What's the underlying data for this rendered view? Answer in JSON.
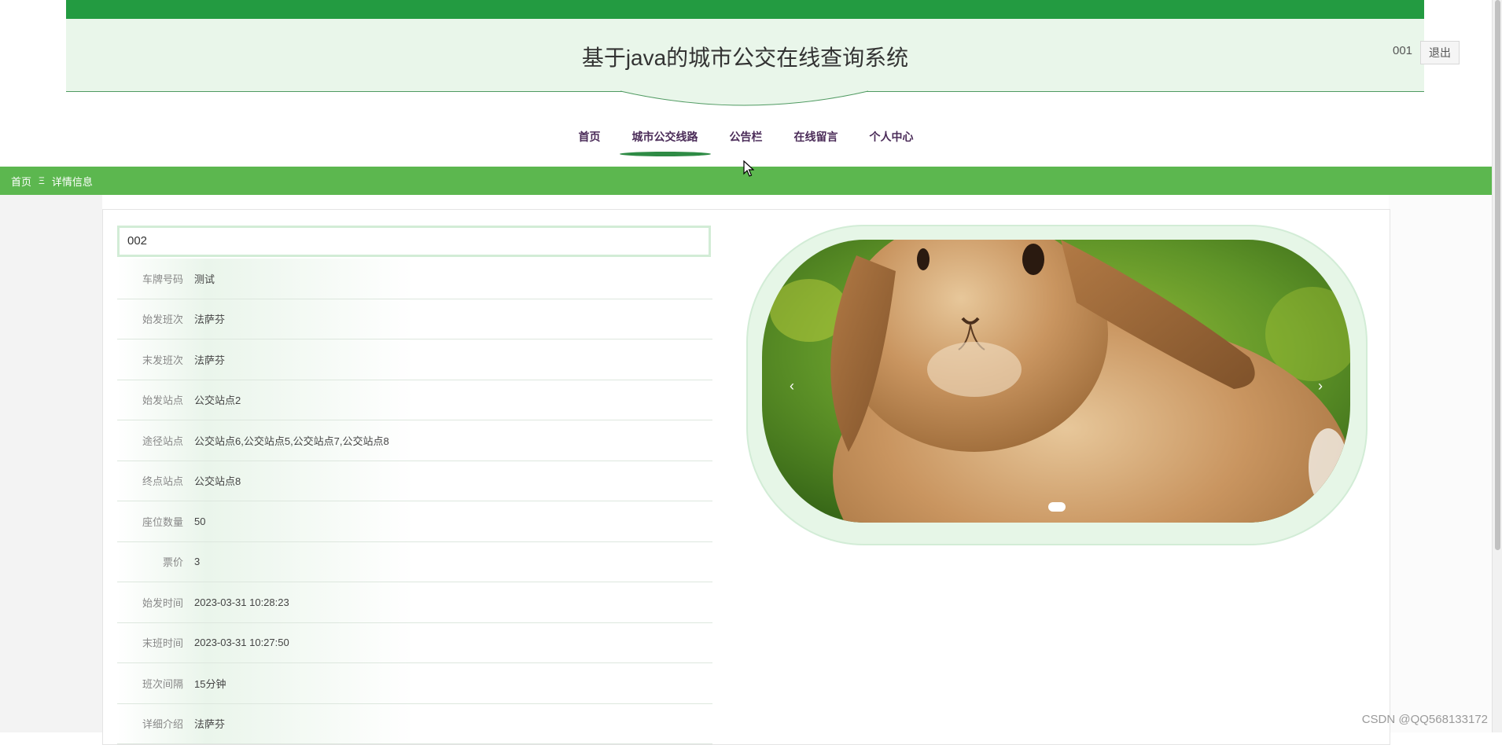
{
  "header": {
    "title": "基于java的城市公交在线查询系统",
    "user": "001",
    "logout_label": "退出"
  },
  "nav": {
    "items": [
      {
        "label": "首页"
      },
      {
        "label": "城市公交线路"
      },
      {
        "label": "公告栏"
      },
      {
        "label": "在线留言"
      },
      {
        "label": "个人中心"
      }
    ],
    "active_index": 1
  },
  "breadcrumb": {
    "home": "首页",
    "separator": "Ξ",
    "current": "详情信息"
  },
  "detail": {
    "title": "002",
    "rows": [
      {
        "label": "车牌号码",
        "value": "测试"
      },
      {
        "label": "始发班次",
        "value": "法萨芬"
      },
      {
        "label": "末发班次",
        "value": "法萨芬"
      },
      {
        "label": "始发站点",
        "value": "公交站点2"
      },
      {
        "label": "途径站点",
        "value": "公交站点6,公交站点5,公交站点7,公交站点8"
      },
      {
        "label": "终点站点",
        "value": "公交站点8"
      },
      {
        "label": "座位数量",
        "value": "50"
      },
      {
        "label": "票价",
        "value": "3"
      },
      {
        "label": "始发时间",
        "value": "2023-03-31 10:28:23"
      },
      {
        "label": "末班时间",
        "value": "2023-03-31 10:27:50"
      },
      {
        "label": "班次间隔",
        "value": "15分钟"
      },
      {
        "label": "详细介绍",
        "value": "法萨芬"
      }
    ]
  },
  "carousel": {
    "image": "rabbit-photo",
    "prev_label": "‹",
    "next_label": "›",
    "slides_count": 1,
    "active_slide": 1
  },
  "watermark": "CSDN @QQ568133172",
  "colors": {
    "top_bar": "#239b41",
    "header_band": "#e9f6ea",
    "breadcrumb_bg": "#5cb74f",
    "nav_text": "#4a2b58",
    "nav_active_underline": "#2e8b45"
  }
}
